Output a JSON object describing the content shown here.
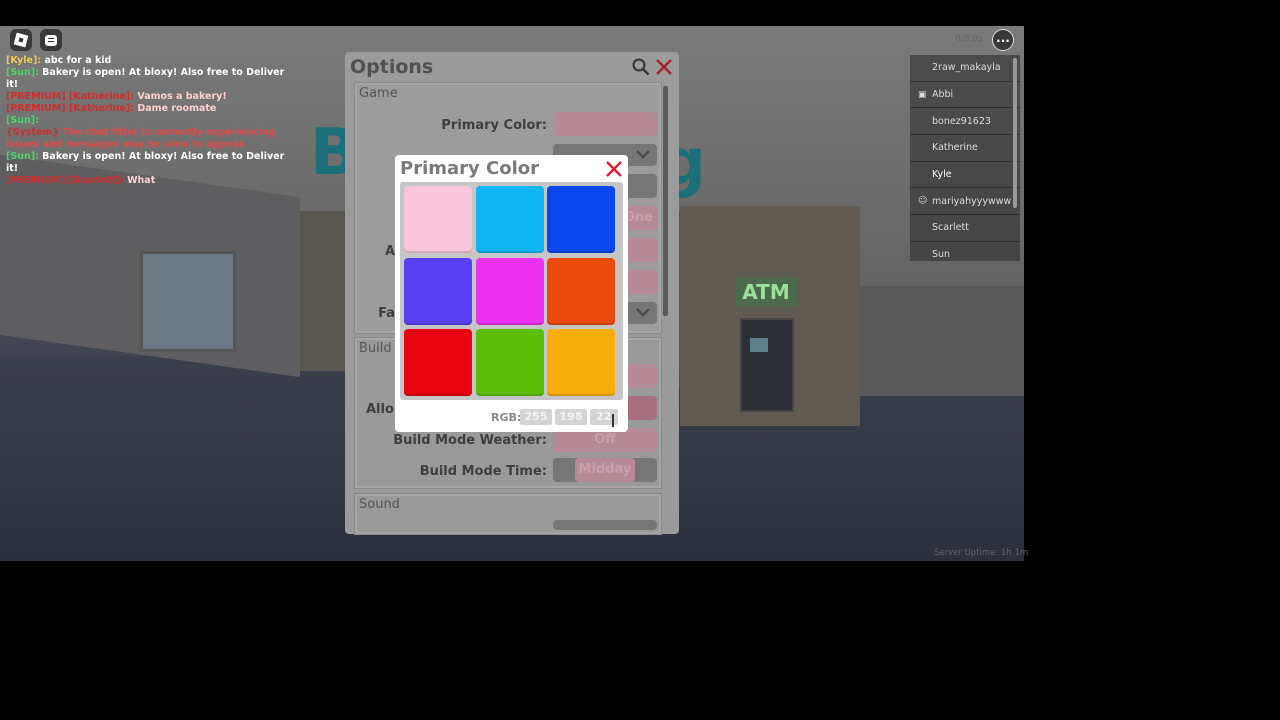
{
  "chat": [
    {
      "speaker": "[Kyle]:",
      "speaker_color": "#f2c75b",
      "message": "abc for a kid",
      "message_color": "#ffffff"
    },
    {
      "speaker": "[Sun]:",
      "speaker_color": "#4cd46a",
      "message": "Bakery is open! At bloxy! Also free to Deliver it!",
      "message_color": "#ffffff"
    },
    {
      "speaker": "[PREMIUM] [Katherine]:",
      "speaker_color": "#d42b2b",
      "message": "Vamos a bakery!",
      "message_color": "#ffd2d2"
    },
    {
      "speaker": "[PREMIUM] [Katherine]:",
      "speaker_color": "#d42b2b",
      "message": "Dame roomate",
      "message_color": "#ffd2d2"
    },
    {
      "speaker": "[Sun]:",
      "speaker_color": "#4cd46a",
      "message": "",
      "message_color": "#ffffff"
    },
    {
      "speaker": "{System}",
      "speaker_color": "#d42b2b",
      "message": "The chat filter is currently experiencing issues and messages may be slow to appear.",
      "message_color": "#e04a4a"
    },
    {
      "speaker": "[Sun]:",
      "speaker_color": "#4cd46a",
      "message": "Bakery is open! At bloxy! Also free to Deliver it!",
      "message_color": "#ffffff"
    },
    {
      "speaker": "[PREMIUM] [Scarlett]:",
      "speaker_color": "#d42b2b",
      "message": "What",
      "message_color": "#ffd2d2"
    }
  ],
  "players": [
    {
      "name": "2raw_makayla",
      "icon": ""
    },
    {
      "name": "Abbi",
      "icon": "premium-icon"
    },
    {
      "name": "bonez91623",
      "icon": ""
    },
    {
      "name": "Katherine",
      "icon": ""
    },
    {
      "name": "Kyle",
      "icon": "",
      "is_self": true
    },
    {
      "name": "mariyahyyywww",
      "icon": "friends-icon"
    },
    {
      "name": "Scarlett",
      "icon": ""
    },
    {
      "name": "Sun",
      "icon": ""
    }
  ],
  "server_uptime": "Server Uptime: 1h 1m",
  "top_right_text": "0.0.0s",
  "scene": {
    "sign_text": "B",
    "sign_text_end": "g",
    "atm_text": "ATM"
  },
  "options": {
    "title": "Options",
    "sections": {
      "game": "Game",
      "build": "Build",
      "sound": "Sound"
    },
    "primary_color_label": "Primary Color:",
    "partial_label_a": "A",
    "partial_label_fa": "Fa",
    "partial_label_allo": "Allo",
    "field_one_text": "One",
    "build_weather_label": "Build Mode Weather:",
    "build_weather_value": "Off",
    "build_time_label": "Build Mode Time:",
    "build_time_value": "Midday"
  },
  "primary_color_popup": {
    "title": "Primary Color",
    "swatches": [
      "#f9c6dc",
      "#10b6f2",
      "#0a48ee",
      "#5940f5",
      "#ea32f0",
      "#ec4a0c",
      "#e8040f",
      "#5cbe0a",
      "#f7ae0c"
    ],
    "rgb_label": "RGB:",
    "rgb": {
      "r": "255",
      "g": "198",
      "b": "220"
    },
    "rgb_b_visible": "22"
  }
}
